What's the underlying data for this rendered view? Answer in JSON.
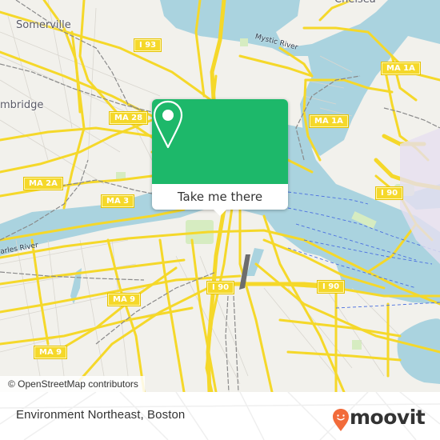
{
  "map": {
    "colors": {
      "land": "#f2f1ec",
      "water": "#aad3df",
      "road_major": "#f5d82a",
      "road_minor": "#ffffff",
      "park": "#d6ecc1",
      "rail": "#8a8a8a",
      "ferry": "#4a6fe0"
    },
    "place_labels": [
      {
        "name": "somerville-label",
        "text": "Somerville"
      },
      {
        "name": "cambridge-label",
        "text": "mbridge"
      },
      {
        "name": "chelsea-label",
        "text": "Chelsea"
      }
    ],
    "water_labels": [
      {
        "name": "mystic-river-label",
        "text": "Mystic River"
      },
      {
        "name": "charles-river-label",
        "text": "arles River"
      }
    ],
    "road_shields": [
      {
        "name": "shield-i93",
        "text": "I 93"
      },
      {
        "name": "shield-ma28",
        "text": "MA 28"
      },
      {
        "name": "shield-ma1a-east",
        "text": "MA 1A"
      },
      {
        "name": "shield-ma1a-center",
        "text": "MA 1A"
      },
      {
        "name": "shield-ma2a",
        "text": "MA 2A"
      },
      {
        "name": "shield-ma3",
        "text": "MA 3"
      },
      {
        "name": "shield-i90-east",
        "text": "I 90"
      },
      {
        "name": "shield-i90-center",
        "text": "I 90"
      },
      {
        "name": "shield-i90-southeast",
        "text": "I 90"
      },
      {
        "name": "shield-ma9-center",
        "text": "MA 9"
      },
      {
        "name": "shield-ma9-west",
        "text": "MA 9"
      }
    ],
    "attribution": "© OpenStreetMap contributors"
  },
  "popup": {
    "icon": "location-pin-icon",
    "accent": "#1db86a",
    "button_label": "Take me there"
  },
  "footer": {
    "place_name": "Environment Northeast, Boston",
    "brand": {
      "name": "moovit",
      "icon": "moovit-smiley-pin-icon",
      "accent": "#f26b3a"
    }
  }
}
